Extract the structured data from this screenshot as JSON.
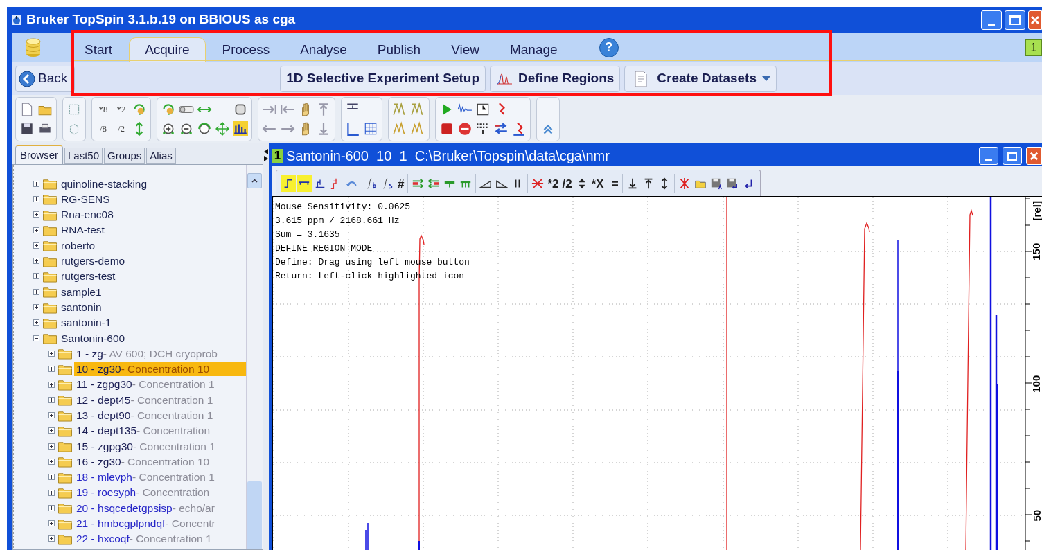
{
  "window": {
    "title": "Bruker TopSpin 3.1.b.19 on BBIOUS as cga"
  },
  "menu_tabs": [
    {
      "label": "Start",
      "selected": false
    },
    {
      "label": "Acquire",
      "selected": true
    },
    {
      "label": "Process",
      "selected": false
    },
    {
      "label": "Analyse",
      "selected": false
    },
    {
      "label": "Publish",
      "selected": false
    },
    {
      "label": "View",
      "selected": false
    },
    {
      "label": "Manage",
      "selected": false
    }
  ],
  "help": {
    "label": "?"
  },
  "window_badge": "1",
  "back_button": {
    "label": "Back"
  },
  "actions": [
    {
      "label": "1D Selective Experiment Setup",
      "kind": "plain"
    },
    {
      "label": "Define Regions",
      "kind": "regions"
    },
    {
      "label": "Create Datasets",
      "kind": "dropdown"
    }
  ],
  "toolbar_labels": [
    "*8",
    "*2",
    "/8",
    "/2"
  ],
  "browser": {
    "tabs": [
      {
        "label": "Browser",
        "selected": true
      },
      {
        "label": "Last50",
        "selected": false
      },
      {
        "label": "Groups",
        "selected": false
      },
      {
        "label": "Alias",
        "selected": false
      }
    ],
    "tree": [
      {
        "label": "quinoline-stacking",
        "expanded": false
      },
      {
        "label": "RG-SENS",
        "expanded": false
      },
      {
        "label": "Rna-enc08",
        "expanded": false
      },
      {
        "label": "RNA-test",
        "expanded": false
      },
      {
        "label": "roberto",
        "expanded": false
      },
      {
        "label": "rutgers-demo",
        "expanded": false
      },
      {
        "label": "rutgers-test",
        "expanded": false
      },
      {
        "label": "sample1",
        "expanded": false
      },
      {
        "label": "santonin",
        "expanded": false
      },
      {
        "label": "santonin-1",
        "expanded": false
      },
      {
        "label": "Santonin-600",
        "expanded": true,
        "children": [
          {
            "label": "1 - zg",
            "description": "- AV 600; DCH cryoprob",
            "kind": "regular",
            "selected": false,
            "expanded": false
          },
          {
            "label": "10 - zg30",
            "description": "- Concentration 10",
            "kind": "regular",
            "selected": true,
            "expanded": false
          },
          {
            "label": "11 - zgpg30",
            "description": "- Concentration 1",
            "kind": "regular",
            "selected": false,
            "expanded": false
          },
          {
            "label": "12 - dept45",
            "description": "- Concentration 1",
            "kind": "regular",
            "selected": false,
            "expanded": false
          },
          {
            "label": "13 - dept90",
            "description": "- Concentration 1",
            "kind": "regular",
            "selected": false,
            "expanded": false
          },
          {
            "label": "14 - dept135",
            "description": "- Concentration",
            "kind": "regular",
            "selected": false,
            "expanded": false
          },
          {
            "label": "15 - zgpg30",
            "description": "- Concentration 1",
            "kind": "regular",
            "selected": false,
            "expanded": false
          },
          {
            "label": "16 - zg30",
            "description": "- Concentration 10",
            "kind": "regular",
            "selected": false,
            "expanded": false
          },
          {
            "label": "18 - mlevph",
            "description": "- Concentration 1",
            "kind": "special",
            "selected": false,
            "expanded": false
          },
          {
            "label": "19 - roesyph",
            "description": "- Concentration",
            "kind": "special",
            "selected": false,
            "expanded": false
          },
          {
            "label": "20 - hsqcedetgpsisp",
            "description": "- echo/ar",
            "kind": "special",
            "selected": false,
            "expanded": false
          },
          {
            "label": "21 - hmbcgplpndqf",
            "description": "- Concentr",
            "kind": "special",
            "selected": false,
            "expanded": false
          },
          {
            "label": "22 - hxcoqf",
            "description": "- Concentration 1",
            "kind": "special",
            "selected": false,
            "expanded": false
          }
        ]
      }
    ]
  },
  "data_window": {
    "badge": "1",
    "title": "Santonin-600  10  1  C:\\Bruker\\Topspin\\data\\cga\\nmr",
    "tool_states": [
      {
        "active": true
      },
      {
        "active": true
      }
    ],
    "toolbar_labels": [
      "#",
      "*2",
      "/2",
      "*X",
      "="
    ],
    "info_lines": [
      "Mouse Sensitivity: 0.0625",
      "3.615 ppm / 2168.661 Hz",
      "Sum = 3.1635",
      "DEFINE REGION MODE",
      "Define: Drag using left mouse button",
      "Return: Left-click highlighted icon"
    ],
    "axis": {
      "label": "[rel]",
      "ticks": [
        "150",
        "100",
        "50"
      ]
    }
  }
}
